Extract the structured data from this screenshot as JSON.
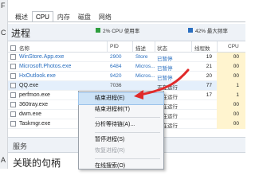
{
  "left_fragments": [
    "F",
    "C",
    "A"
  ],
  "tabs": [
    {
      "label": "概述",
      "active": false
    },
    {
      "label": "CPU",
      "active": true
    },
    {
      "label": "内存",
      "active": false
    },
    {
      "label": "磁盘",
      "active": false
    },
    {
      "label": "网络",
      "active": false
    }
  ],
  "group": {
    "title": "进程",
    "cpu_summary": "2% CPU 使用率",
    "mem_summary": "42% 最大频率",
    "cpu_color": "#2e9e3e",
    "mem_color": "#2a6fc0"
  },
  "columns": {
    "name": "名称",
    "pid": "PID",
    "desc": "描述",
    "status": "状态",
    "threads": "线程数",
    "cpu": "CPU"
  },
  "processes": [
    {
      "name": "WinStore.App.exe",
      "pid": "2900",
      "desc": "Store",
      "status": "已暂停",
      "threads": "19",
      "cpu": "00"
    },
    {
      "name": "Microsoft.Photos.exe",
      "pid": "6484",
      "desc": "Micros...",
      "status": "已暂停",
      "threads": "21",
      "cpu": "00"
    },
    {
      "name": "HxOutlook.exe",
      "pid": "9420",
      "desc": "Micros...",
      "status": "已暂停",
      "threads": "20",
      "cpu": "00"
    },
    {
      "name": "QQ.exe",
      "pid": "7036",
      "desc": "",
      "status": "正在运行",
      "threads": "77",
      "cpu": "1"
    },
    {
      "name": "perfmon.exe",
      "pid": "",
      "desc": "",
      "status": "正在运行",
      "threads": "17",
      "cpu": "1"
    },
    {
      "name": "360tray.exe",
      "pid": "",
      "desc": "",
      "status": "正在运行",
      "threads": "",
      "cpu": "00"
    },
    {
      "name": "dwm.exe",
      "pid": "",
      "desc": "",
      "status": "正在运行",
      "threads": "",
      "cpu": "00"
    },
    {
      "name": "Taskmgr.exe",
      "pid": "",
      "desc": "",
      "status": "正在运行",
      "threads": "",
      "cpu": "00"
    }
  ],
  "context_menu": {
    "end_process": "结束进程(E)",
    "end_process_tree": "结束进程树(T)",
    "analyze_wait_chain": "分析等待链(A)...",
    "suspend_process": "暂停进程(S)",
    "resume_process": "恢复进程(R)",
    "search_online": "在线搜索(O)"
  },
  "services_label": "服务",
  "bottom_title": "关联的句柄",
  "annotation_color": "#e02a2a"
}
